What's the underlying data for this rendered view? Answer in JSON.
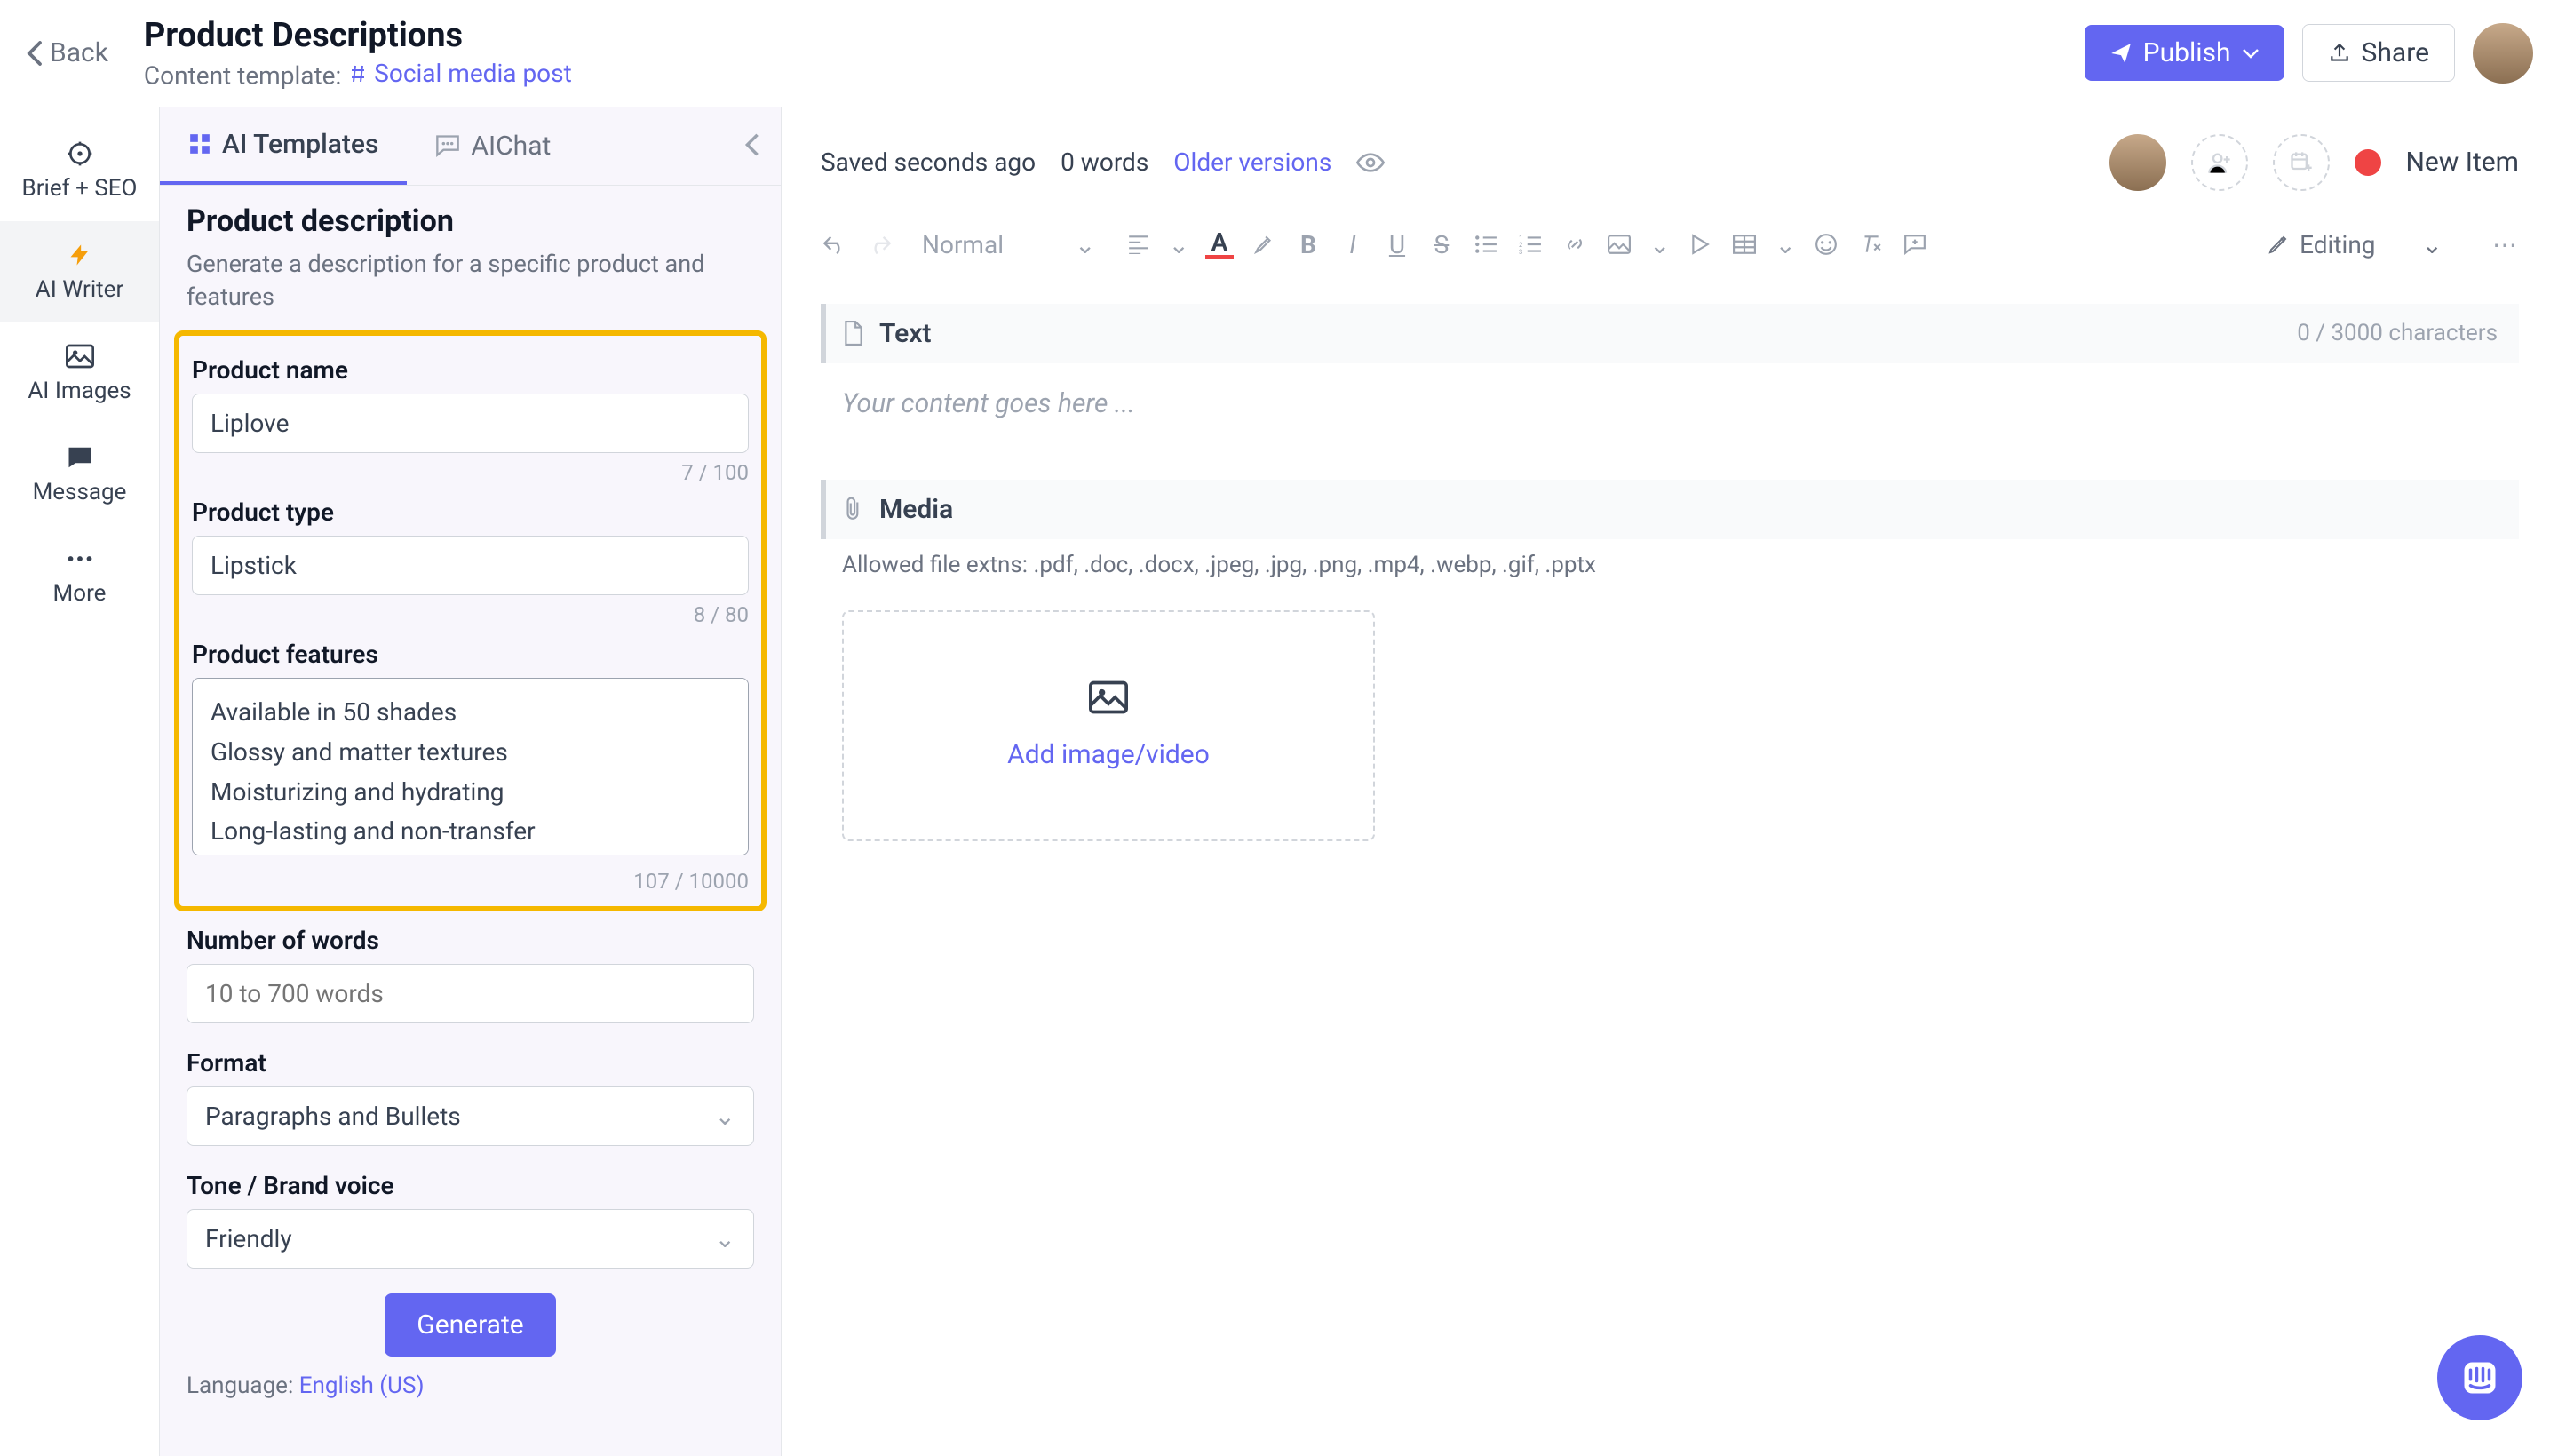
{
  "topbar": {
    "back": "Back",
    "title": "Product Descriptions",
    "template_label": "Content template:",
    "template_value": "Social media post",
    "publish": "Publish",
    "share": "Share"
  },
  "rail": {
    "brief": "Brief + SEO",
    "writer": "AI Writer",
    "images": "AI Images",
    "message": "Message",
    "more": "More"
  },
  "panel": {
    "tab_templates": "AI Templates",
    "tab_chat": "AIChat",
    "heading": "Product description",
    "subheading": "Generate a description for a specific product and features",
    "product_name_label": "Product name",
    "product_name_value": "Liplove",
    "product_name_count": "7 / 100",
    "product_type_label": "Product type",
    "product_type_value": "Lipstick",
    "product_type_count": "8 / 80",
    "features_label": "Product features",
    "features_value": "Available in 50 shades\nGlossy and matter textures\nMoisturizing and hydrating\nLong-lasting and non-transfer",
    "features_count": "107 / 10000",
    "words_label": "Number of words",
    "words_placeholder": "10 to 700 words",
    "format_label": "Format",
    "format_value": "Paragraphs and Bullets",
    "tone_label": "Tone / Brand voice",
    "tone_value": "Friendly",
    "generate": "Generate",
    "lang_label": "Language: ",
    "lang_value": "English (US)"
  },
  "main": {
    "saved": "Saved seconds ago",
    "wordcount": "0 words",
    "older": "Older versions",
    "status": "New Item",
    "normal": "Normal",
    "editing": "Editing",
    "text_block": "Text",
    "text_counter": "0 / 3000 characters",
    "text_placeholder": "Your content goes here ...",
    "media_block": "Media",
    "media_hint": "Allowed file extns: .pdf, .doc, .docx, .jpeg, .jpg, .png, .mp4, .webp, .gif, .pptx",
    "add_media": "Add image/video"
  }
}
